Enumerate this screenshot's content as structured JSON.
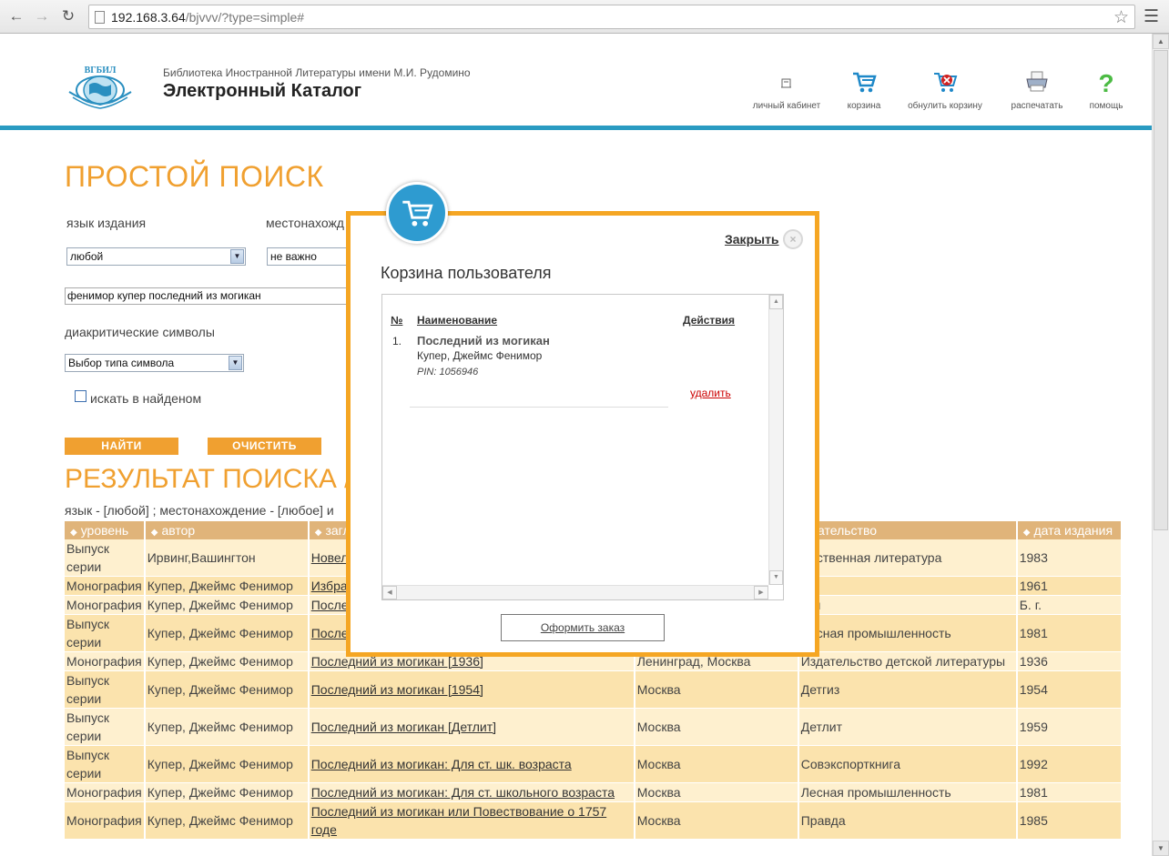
{
  "browser": {
    "url_host": "192.168.3.64",
    "url_path": "/bjvvv/?type=simple#"
  },
  "header": {
    "logo_text": "ВГБИЛ",
    "library_name": "Библиотека Иностранной Литературы имени М.И. Рудомино",
    "catalog_title": "Электронный Каталог",
    "tools": [
      {
        "label": "личный кабинет",
        "icon": "user-icon"
      },
      {
        "label": "корзина",
        "icon": "cart-icon"
      },
      {
        "label": "обнулить корзину",
        "icon": "clear-cart-icon"
      },
      {
        "label": "распечатать",
        "icon": "printer-icon"
      },
      {
        "label": "помощь",
        "icon": "help-icon"
      }
    ]
  },
  "search": {
    "title": "ПРОСТОЙ ПОИСК",
    "lang_label": "язык издания",
    "lang_value": "любой",
    "location_label": "местонахожд",
    "location_value": "не важно",
    "query_value": "фенимор купер последний из могикан",
    "diacritic_label": "диакритические символы",
    "diacritic_value": "Выбор типа символа",
    "search_in_found_label": "искать в найденом",
    "find_button": "НАЙТИ",
    "clear_button": "ОЧИСТИТЬ"
  },
  "results": {
    "title": "РЕЗУЛЬТАТ ПОИСКА /",
    "meta": "язык - [любой] ; местонахождение - [любое] и",
    "columns": [
      "уровень",
      "автор",
      "загл",
      "",
      "здательство",
      "дата издания"
    ],
    "rows": [
      {
        "level": "Выпуск серии",
        "author": "Ирвинг,Вашингтон",
        "title": "Новелл Роман. ",
        "place": "",
        "publisher": "жественная литература",
        "date": "1983"
      },
      {
        "level": "Монография",
        "author": "Купер, Джеймс Фенимор",
        "title": "Избран томах. 7",
        "place": "",
        "publisher": "гиз",
        "date": "1961"
      },
      {
        "level": "Монография",
        "author": "Купер, Джеймс Фенимор",
        "title": "Послед",
        "place": "",
        "publisher": "кин",
        "date": "Б. г."
      },
      {
        "level": "Выпуск серии",
        "author": "Купер, Джеймс Фенимор",
        "title": "Последний из могикан",
        "place": "Москва",
        "publisher": "Лесная промышленность",
        "date": "1981"
      },
      {
        "level": "Монография",
        "author": "Купер, Джеймс Фенимор",
        "title": "Последний из могикан [1936]",
        "place": "Ленинград, Москва",
        "publisher": "Издательство детской литературы",
        "date": "1936"
      },
      {
        "level": "Выпуск серии",
        "author": "Купер, Джеймс Фенимор",
        "title": "Последний из могикан [1954]",
        "place": "Москва",
        "publisher": "Детгиз",
        "date": "1954"
      },
      {
        "level": "Выпуск серии",
        "author": "Купер, Джеймс Фенимор",
        "title": "Последний из могикан [Детлит]",
        "place": "Москва",
        "publisher": "Детлит",
        "date": "1959"
      },
      {
        "level": "Выпуск серии",
        "author": "Купер, Джеймс Фенимор",
        "title": "Последний из могикан: Для ст. шк. возраста",
        "place": "Москва",
        "publisher": "Совэкспорткнига",
        "date": "1992"
      },
      {
        "level": "Монография",
        "author": "Купер, Джеймс Фенимор",
        "title": "Последний из могикан: Для ст. школьного возраста",
        "place": "Москва",
        "publisher": "Лесная промышленность",
        "date": "1981"
      },
      {
        "level": "Монография",
        "author": "Купер, Джеймс Фенимор",
        "title": "Последний из могикан или Повествование о 1757 годе",
        "place": "Москва",
        "publisher": "Правда",
        "date": "1985"
      }
    ]
  },
  "modal": {
    "close_label": "Закрыть",
    "title": "Корзина пользователя",
    "col_num": "№",
    "col_name": "Наименование",
    "col_actions": "Действия",
    "item": {
      "num": "1.",
      "title": "Последний из могикан",
      "author": "Купер, Джеймс Фенимор",
      "pin": "PIN: 1056946",
      "delete_label": "удалить"
    },
    "order_button": "Оформить заказ"
  },
  "colors": {
    "accent_orange": "#f0a030",
    "modal_border": "#f5a623",
    "header_line": "#2a9bc2",
    "table_header": "#e0b47a"
  }
}
